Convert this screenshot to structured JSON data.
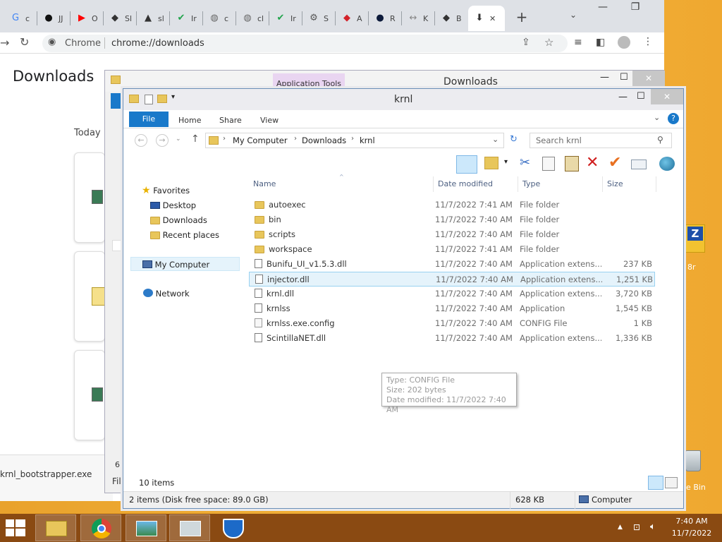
{
  "desktop": {
    "icon_label_partial": "8r",
    "recycle_label": "le Bin"
  },
  "chrome": {
    "tabs": [
      {
        "fav": "G",
        "label": "c",
        "color": "#4285f4"
      },
      {
        "fav": "●",
        "label": "JJ",
        "color": "#111"
      },
      {
        "fav": "▶",
        "label": "O",
        "color": "#ff0000"
      },
      {
        "fav": "◆",
        "label": "Sl",
        "color": "#333"
      },
      {
        "fav": "▲",
        "label": "sl",
        "color": "#333"
      },
      {
        "fav": "✔",
        "label": "Ir",
        "color": "#1fa34a"
      },
      {
        "fav": "◍",
        "label": "c",
        "color": "#666"
      },
      {
        "fav": "◍",
        "label": "cl",
        "color": "#666"
      },
      {
        "fav": "✔",
        "label": "Ir",
        "color": "#1fa34a"
      },
      {
        "fav": "⚙",
        "label": "S",
        "color": "#555"
      },
      {
        "fav": "◆",
        "label": "A",
        "color": "#d3222a"
      },
      {
        "fav": "●",
        "label": "R",
        "color": "#0c1a3a"
      },
      {
        "fav": "↔",
        "label": "K",
        "color": "#888"
      },
      {
        "fav": "◆",
        "label": "B",
        "color": "#333"
      },
      {
        "fav": "⬇",
        "label": "✕",
        "color": "#333"
      }
    ],
    "new_tab": "+",
    "url_site": "Chrome",
    "url": "chrome://downloads",
    "page_title": "Downloads",
    "section_today": "Today",
    "bottom_file": "krnl_bootstrapper.exe",
    "bottom_file_label": "File"
  },
  "back_window": {
    "app_tools": "Application Tools",
    "title": "Downloads"
  },
  "explorer": {
    "title": "krnl",
    "ribbon_tabs": [
      "File",
      "Home",
      "Share",
      "View"
    ],
    "breadcrumb": [
      "My Computer",
      "Downloads",
      "krnl"
    ],
    "search_placeholder": "Search krnl",
    "columns": {
      "name": "Name",
      "date": "Date modified",
      "type": "Type",
      "size": "Size"
    },
    "nav": {
      "favorites": "Favorites",
      "desktop": "Desktop",
      "downloads": "Downloads",
      "recent": "Recent places",
      "computer": "My Computer",
      "network": "Network"
    },
    "files": [
      {
        "name": "autoexec",
        "date": "11/7/2022 7:41 AM",
        "type": "File folder",
        "size": "",
        "kind": "folder"
      },
      {
        "name": "bin",
        "date": "11/7/2022 7:40 AM",
        "type": "File folder",
        "size": "",
        "kind": "folder"
      },
      {
        "name": "scripts",
        "date": "11/7/2022 7:40 AM",
        "type": "File folder",
        "size": "",
        "kind": "folder"
      },
      {
        "name": "workspace",
        "date": "11/7/2022 7:41 AM",
        "type": "File folder",
        "size": "",
        "kind": "folder"
      },
      {
        "name": "Bunifu_UI_v1.5.3.dll",
        "date": "11/7/2022 7:40 AM",
        "type": "Application extens...",
        "size": "237 KB",
        "kind": "dll"
      },
      {
        "name": "injector.dll",
        "date": "11/7/2022 7:40 AM",
        "type": "Application extens...",
        "size": "1,251 KB",
        "kind": "dll",
        "selected": true
      },
      {
        "name": "krnl.dll",
        "date": "11/7/2022 7:40 AM",
        "type": "Application extens...",
        "size": "3,720 KB",
        "kind": "dll"
      },
      {
        "name": "krnlss",
        "date": "11/7/2022 7:40 AM",
        "type": "Application",
        "size": "1,545 KB",
        "kind": "app"
      },
      {
        "name": "krnlss.exe.config",
        "date": "11/7/2022 7:40 AM",
        "type": "CONFIG File",
        "size": "1 KB",
        "kind": "cfg"
      },
      {
        "name": "ScintillaNET.dll",
        "date": "11/7/2022 7:40 AM",
        "type": "Application extens...",
        "size": "1,336 KB",
        "kind": "dll"
      }
    ],
    "tooltip": {
      "line1": "Type: CONFIG File",
      "line2": "Size: 202 bytes",
      "line3": "Date modified: 11/7/2022 7:40 AM"
    },
    "item_count": "10 items",
    "status_left": "2 items (Disk free space: 89.0 GB)",
    "status_size": "628 KB",
    "status_location": "Computer"
  },
  "taskbar": {
    "time": "7:40 AM",
    "date": "11/7/2022"
  }
}
